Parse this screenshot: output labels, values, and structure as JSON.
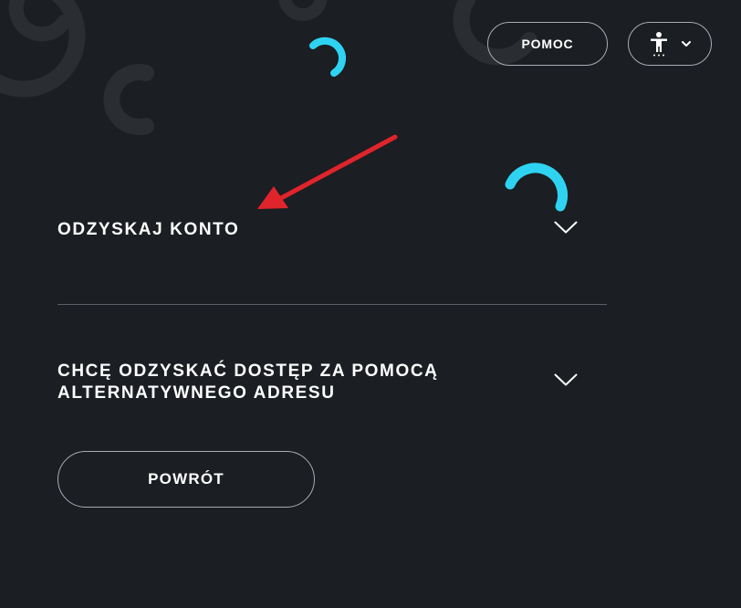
{
  "header": {
    "help_label": "POMOC",
    "accessibility_icon": "accessibility-person-icon",
    "accessibility_dropdown_icon": "chevron-down-icon"
  },
  "sections": [
    {
      "title": "ODZYSKAJ KONTO",
      "icon": "chevron-down-icon"
    },
    {
      "title": "CHCĘ ODZYSKAĆ DOSTĘP ZA POMOCĄ ALTERNATYWNEGO ADRESU",
      "icon": "chevron-down-icon"
    }
  ],
  "actions": {
    "back_label": "POWRÓT"
  },
  "colors": {
    "background": "#1b1e22",
    "accent": "#2ed3f2",
    "decor": "#2a2d31",
    "border": "#a9adb3",
    "annotation": "#e0242b"
  }
}
